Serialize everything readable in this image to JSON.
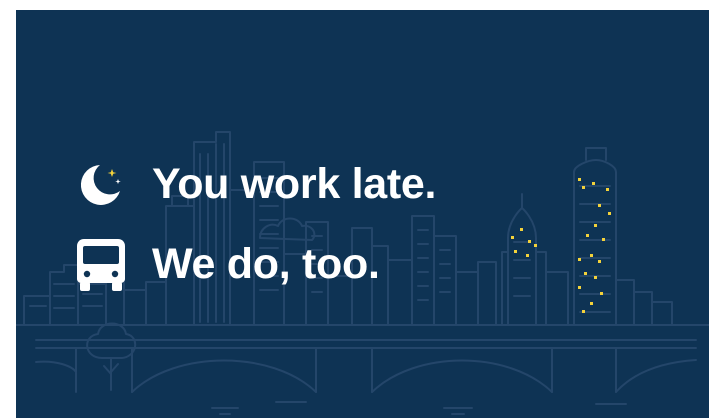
{
  "banner": {
    "background_color": "#0e3354",
    "line_color": "#24466a",
    "window_light_color": "#f3d23b",
    "headline_1": "You work late.",
    "headline_2": "We do, too.",
    "icons": [
      "crescent-moon-with-stars-icon",
      "bus-front-icon"
    ]
  }
}
